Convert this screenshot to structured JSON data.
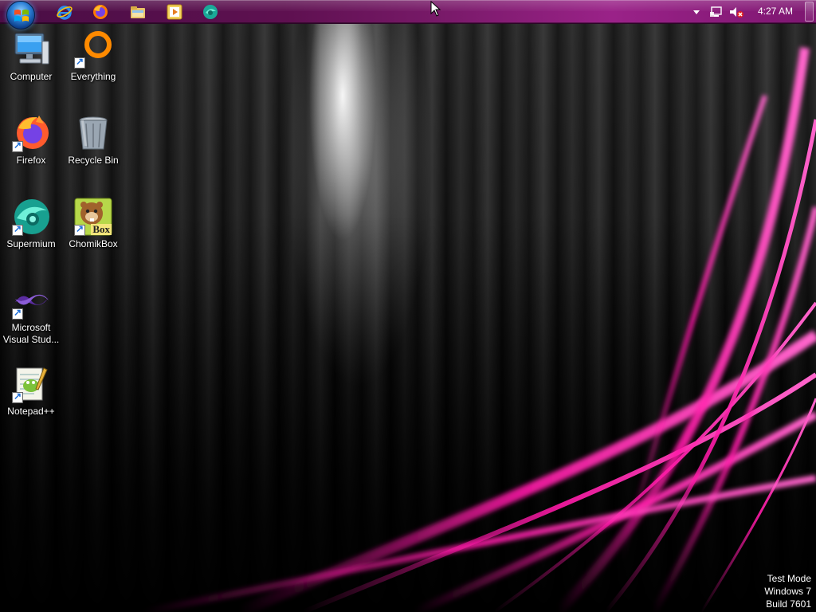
{
  "taskbar": {
    "start_button": "start-orb",
    "quick_launch": [
      {
        "name": "internet-explorer"
      },
      {
        "name": "firefox"
      },
      {
        "name": "windows-explorer"
      },
      {
        "name": "media-player"
      },
      {
        "name": "supermium"
      }
    ],
    "tray": {
      "show_hidden_icons": "chevron-down-icon",
      "network": "network-icon",
      "volume": "volume-muted-icon",
      "clock": "4:27 AM"
    }
  },
  "desktop": {
    "icons": [
      {
        "id": "computer",
        "label": "Computer"
      },
      {
        "id": "everything",
        "label": "Everything"
      },
      {
        "id": "firefox",
        "label": "Firefox"
      },
      {
        "id": "recycle-bin",
        "label": "Recycle Bin"
      },
      {
        "id": "supermium",
        "label": "Supermium"
      },
      {
        "id": "chomikbox",
        "label": "ChomikBox"
      },
      {
        "id": "visual-studio",
        "label": "Microsoft Visual Stud..."
      },
      {
        "id": "notepad-plus-plus",
        "label": "Notepad++"
      }
    ],
    "chomikbox_badge": "Box"
  },
  "watermark": {
    "line1": "Test Mode",
    "line2": "Windows 7",
    "line3": "Build 7601"
  },
  "colors": {
    "taskbar_accent": "#7a1a6a",
    "wallpaper_streak": "#ff1aa8"
  }
}
